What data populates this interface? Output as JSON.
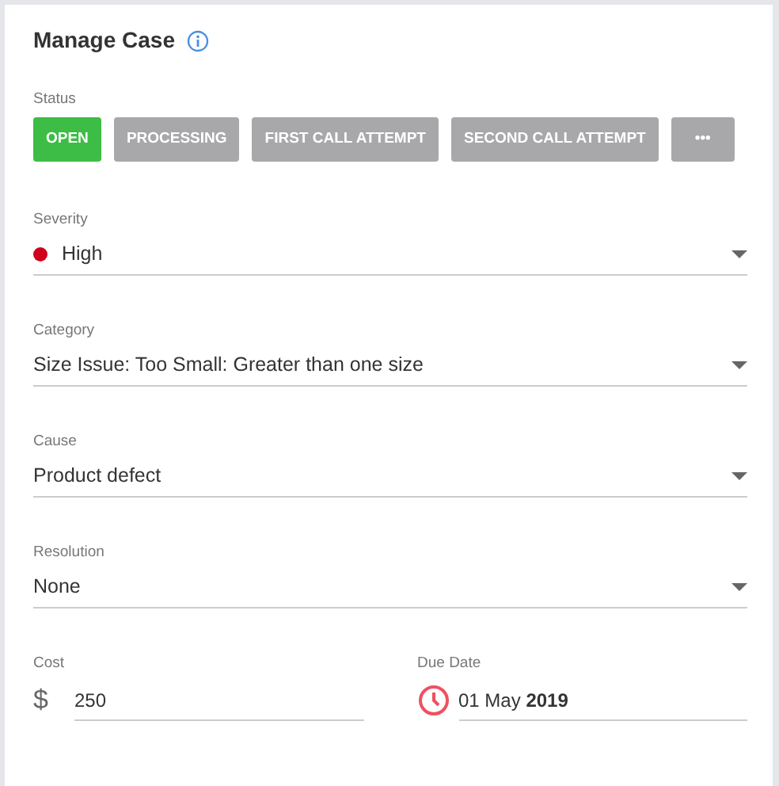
{
  "title": "Manage Case",
  "status": {
    "label": "Status",
    "options": [
      {
        "label": "OPEN",
        "selected": true
      },
      {
        "label": "PROCESSING",
        "selected": false
      },
      {
        "label": "FIRST CALL ATTEMPT",
        "selected": false
      },
      {
        "label": "SECOND CALL ATTEMPT",
        "selected": false
      }
    ],
    "more": "•••"
  },
  "selects": [
    {
      "label": "Severity",
      "value": "High",
      "color": "#d0021b"
    },
    {
      "label": "Category",
      "value": "Size Issue: Too Small: Greater than one size"
    },
    {
      "label": "Cause",
      "value": "Product defect"
    },
    {
      "label": "Resolution",
      "value": "None"
    }
  ],
  "cost": {
    "label": "Cost",
    "prefix": "$",
    "value": "250"
  },
  "due_date": {
    "label": "Due Date",
    "value": "01 May **2019**"
  }
}
